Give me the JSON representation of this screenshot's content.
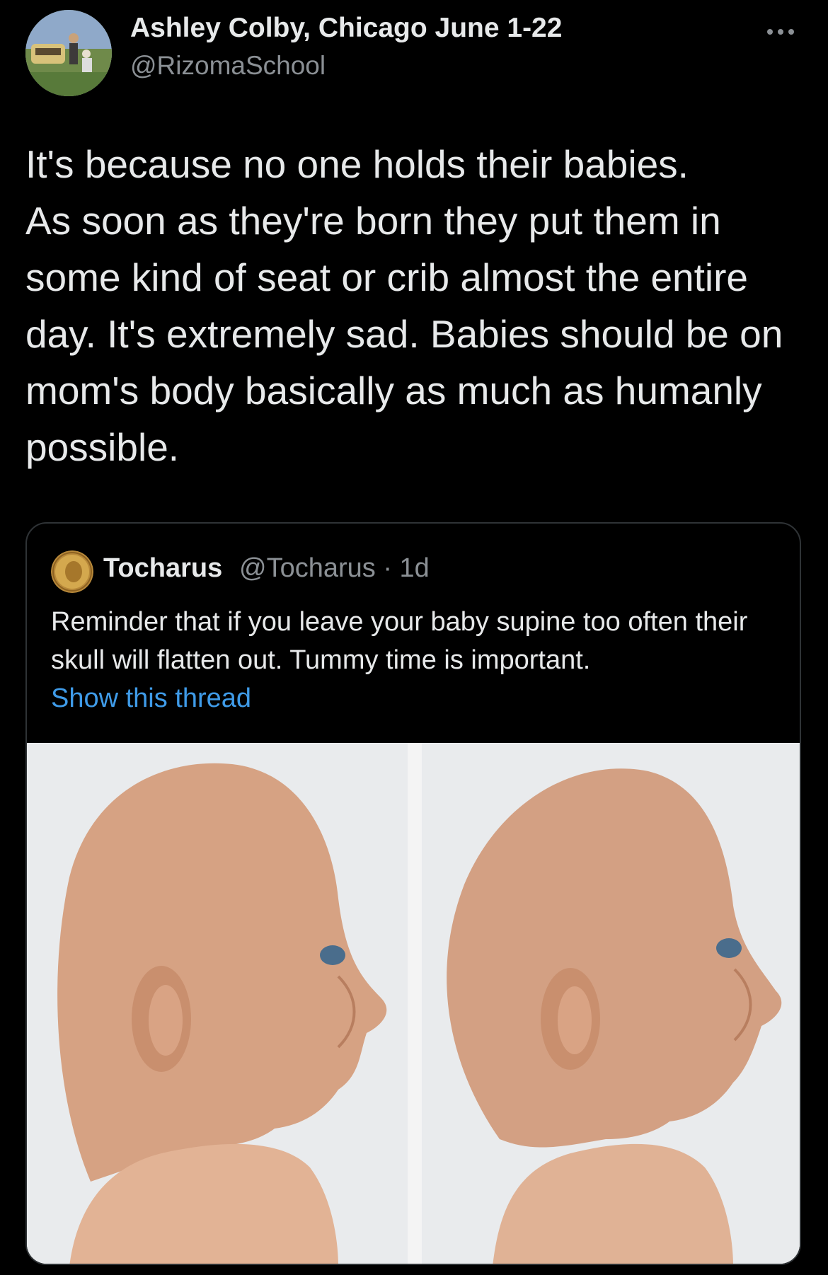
{
  "tweet": {
    "author_name": "Ashley Colby, Chicago June 1-22",
    "author_handle": "@RizomaSchool",
    "text": "It's because no one holds their babies.\nAs soon as they're born they put them in some kind of seat or crib almost the entire day. It's extremely sad. Babies should be on mom's body basically as much as humanly possible.",
    "more_icon": "ellipsis-icon"
  },
  "quoted_tweet": {
    "author_name": "Tocharus",
    "meta": "@Tocharus · 1d",
    "text": "Reminder that if you leave your baby supine too often their skull will flatten out. Tummy time is important.",
    "show_thread": "Show this thread"
  },
  "colors": {
    "background": "#000000",
    "text": "#e7e9ea",
    "secondary": "#8b9095",
    "link": "#3f9be8",
    "border": "#2f3336"
  }
}
